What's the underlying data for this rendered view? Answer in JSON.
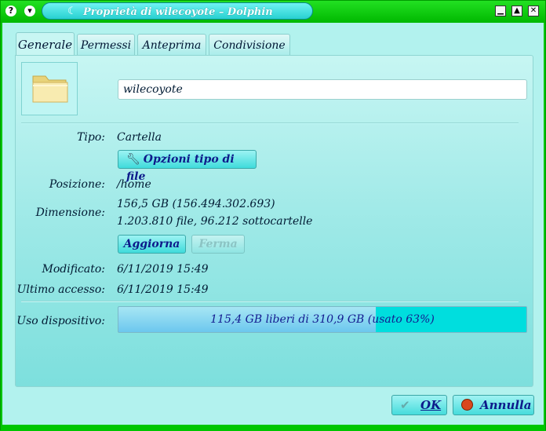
{
  "window": {
    "title": "Proprietà di wilecoyote – Dolphin",
    "menu_button_glyph": "?",
    "shade_button_glyph": "▾",
    "minimize_glyph": "▁",
    "maximize_glyph": "▲",
    "close_glyph": "✕"
  },
  "tabs": [
    {
      "label": "Generale",
      "active": true
    },
    {
      "label": "Permessi",
      "active": false
    },
    {
      "label": "Anteprima",
      "active": false
    },
    {
      "label": "Condivisione",
      "active": false
    }
  ],
  "general": {
    "icon": "folder-icon",
    "name_value": "wilecoyote",
    "type_label": "Tipo:",
    "type_value": "Cartella",
    "file_type_options_button": "Opzioni tipo di file",
    "location_label": "Posizione:",
    "location_value": "/home",
    "size_label": "Dimensione:",
    "size_value": "156,5 GB (156.494.302.693)",
    "size_contents": "1.203.810 file, 96.212 sottocartelle",
    "refresh_button": "Aggiorna",
    "stop_button": "Ferma",
    "modified_label": "Modificato:",
    "modified_value": "6/11/2019 15:49",
    "accessed_label": "Ultimo accesso:",
    "accessed_value": "6/11/2019 15:49",
    "device_usage_label": "Uso dispositivo:",
    "device_usage_text": "115,4 GB liberi di 310,9 GB (usato 63%)",
    "device_usage_percent": 63
  },
  "footer": {
    "ok_button": "OK",
    "cancel_button": "Annulla"
  },
  "colors": {
    "frame": "#00c600",
    "dialog_background": "#b2f2ee",
    "usage_remaining": "#00dede",
    "button_text": "#0d1a8a"
  }
}
